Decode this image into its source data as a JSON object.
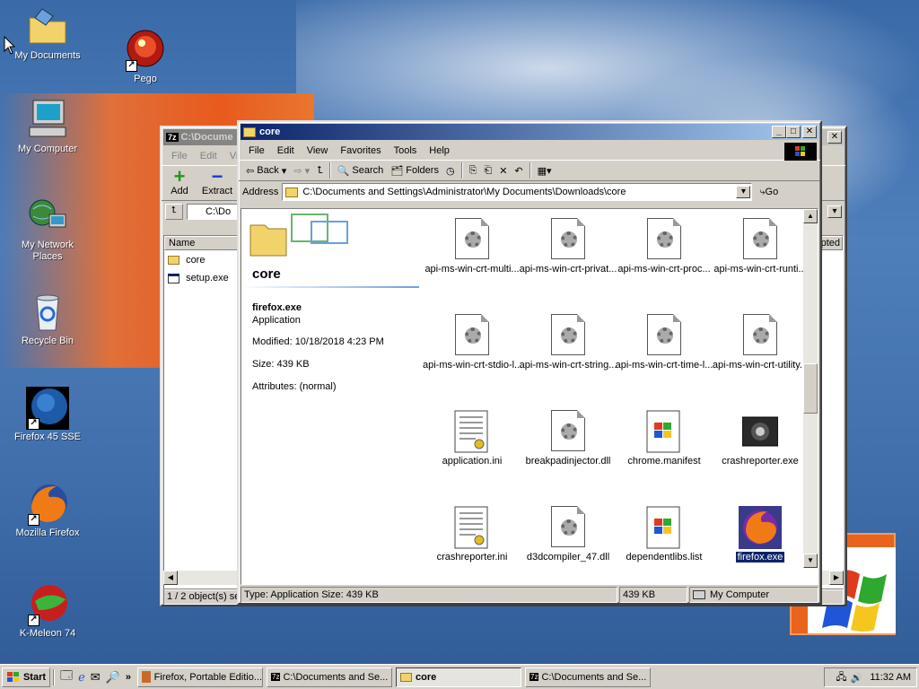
{
  "desktop": {
    "icons": [
      {
        "label": "My Documents"
      },
      {
        "label": "Pego"
      },
      {
        "label": "My Computer"
      },
      {
        "label": "My Network Places"
      },
      {
        "label": "Recycle Bin"
      },
      {
        "label": "Firefox 45 SSE"
      },
      {
        "label": "Mozilla Firefox"
      },
      {
        "label": "K-Meleon 74"
      }
    ]
  },
  "back_window": {
    "title": "C:\\Docume",
    "menu": [
      "File",
      "Edit",
      "View"
    ],
    "add_label": "Add",
    "extract_label": "Extract",
    "path": "C:\\Do",
    "col_name": "Name",
    "col_right": "pted",
    "files": [
      "core",
      "setup.exe"
    ],
    "status": "1 / 2 object(s) se"
  },
  "main_window": {
    "title": "core",
    "menu": [
      "File",
      "Edit",
      "View",
      "Favorites",
      "Tools",
      "Help"
    ],
    "toolbar": {
      "back": "Back",
      "search": "Search",
      "folders": "Folders"
    },
    "address_label": "Address",
    "address_value": "C:\\Documents and Settings\\Administrator\\My Documents\\Downloads\\core",
    "go_label": "Go",
    "panel": {
      "folder_name": "core",
      "selected_name": "firefox.exe",
      "selected_type": "Application",
      "modified": "Modified: 10/18/2018 4:23 PM",
      "size": "Size: 439 KB",
      "attributes": "Attributes: (normal)"
    },
    "files": [
      {
        "name": "api-ms-win-crt-multi...",
        "kind": "dll"
      },
      {
        "name": "api-ms-win-crt-privat...",
        "kind": "dll"
      },
      {
        "name": "api-ms-win-crt-proc...",
        "kind": "dll"
      },
      {
        "name": "api-ms-win-crt-runti...",
        "kind": "dll"
      },
      {
        "name": "api-ms-win-crt-stdio-l...",
        "kind": "dll"
      },
      {
        "name": "api-ms-win-crt-string...",
        "kind": "dll"
      },
      {
        "name": "api-ms-win-crt-time-l...",
        "kind": "dll"
      },
      {
        "name": "api-ms-win-crt-utility...",
        "kind": "dll"
      },
      {
        "name": "application.ini",
        "kind": "ini"
      },
      {
        "name": "breakpadinjector.dll",
        "kind": "dll"
      },
      {
        "name": "chrome.manifest",
        "kind": "win"
      },
      {
        "name": "crashreporter.exe",
        "kind": "crash"
      },
      {
        "name": "crashreporter.ini",
        "kind": "ini"
      },
      {
        "name": "d3dcompiler_47.dll",
        "kind": "dll"
      },
      {
        "name": "dependentlibs.list",
        "kind": "win"
      },
      {
        "name": "firefox.exe",
        "kind": "firefox"
      }
    ],
    "status": {
      "left": "Type: Application Size: 439 KB",
      "size": "439 KB",
      "zone": "My Computer"
    }
  },
  "taskbar": {
    "start": "Start",
    "tasks": [
      {
        "label": "Firefox, Portable Editio..."
      },
      {
        "label": "C:\\Documents and Se..."
      },
      {
        "label": "core"
      },
      {
        "label": "C:\\Documents and Se..."
      }
    ],
    "clock": "11:32 AM"
  }
}
